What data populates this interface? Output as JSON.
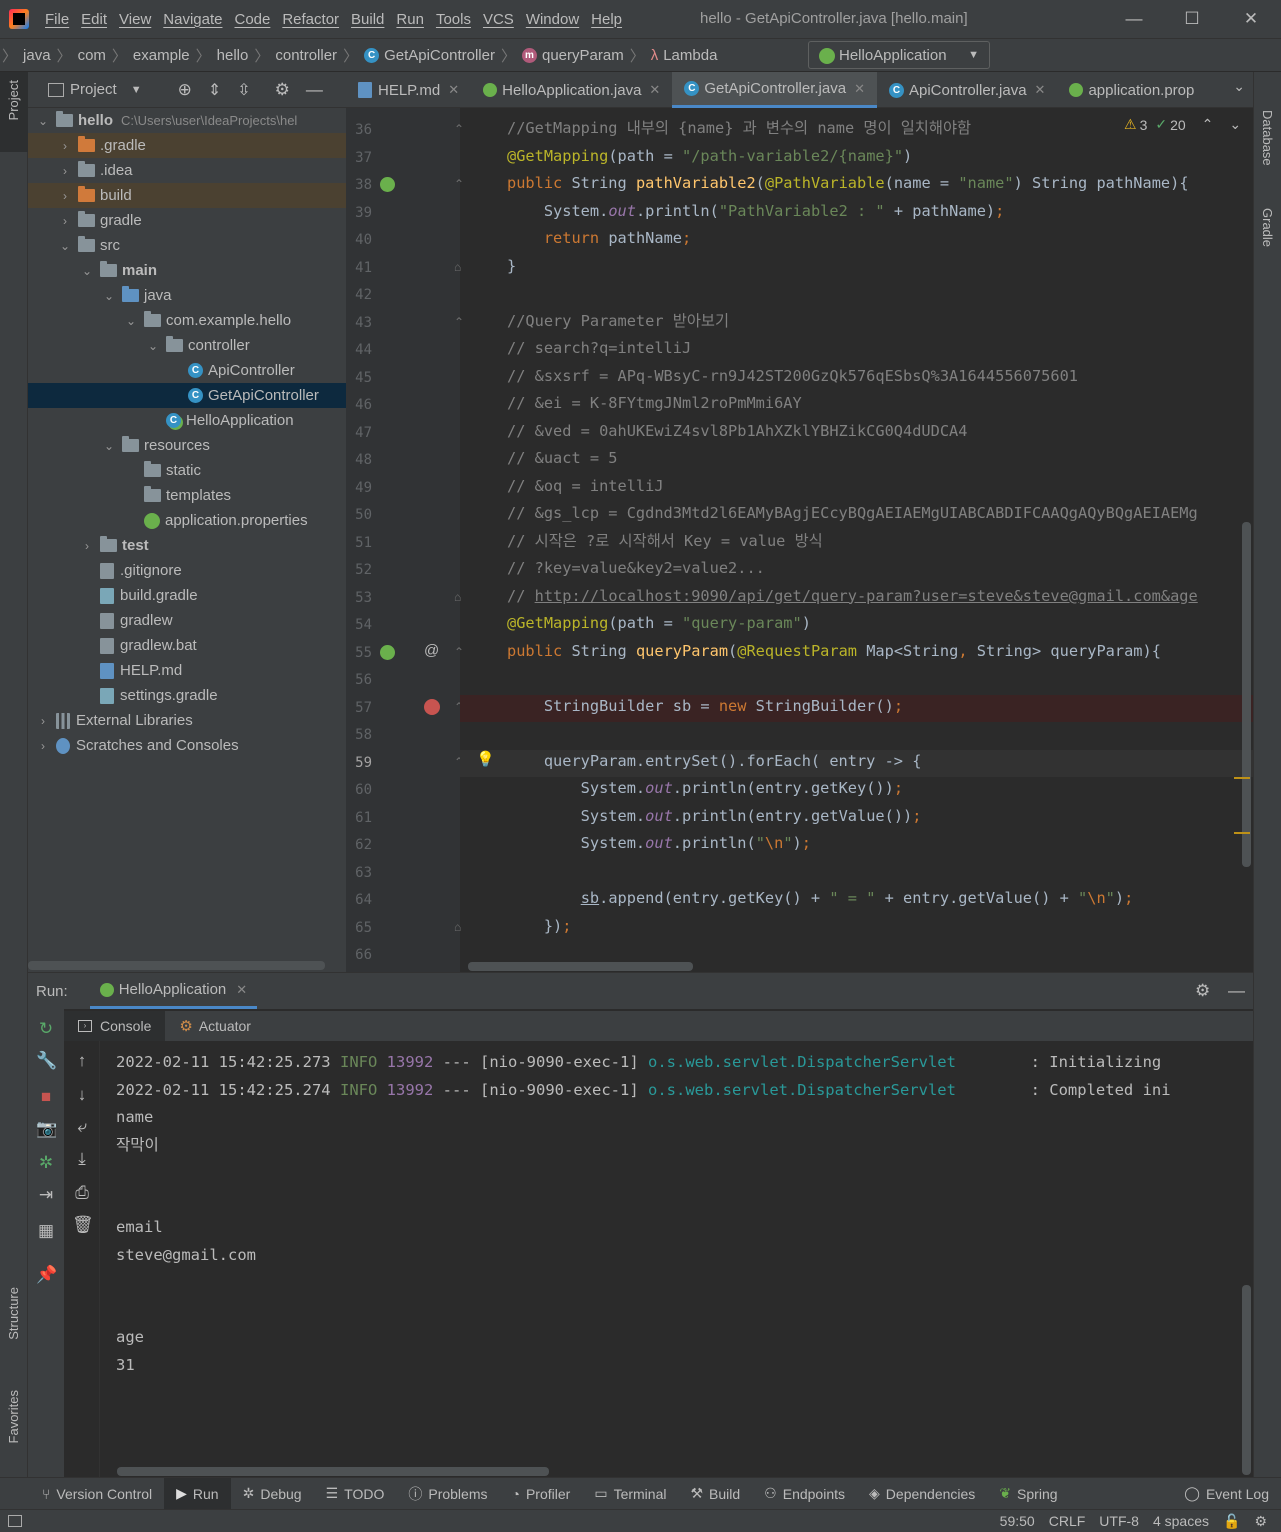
{
  "menu": [
    "File",
    "Edit",
    "View",
    "Navigate",
    "Code",
    "Refactor",
    "Build",
    "Run",
    "Tools",
    "VCS",
    "Window",
    "Help"
  ],
  "window_title": "hello - GetApiController.java [hello.main]",
  "breadcrumbs": [
    "java",
    "com",
    "example",
    "hello",
    "controller",
    "GetApiController",
    "queryParam",
    "Lambda"
  ],
  "run_config": "HelloApplication",
  "project_panel": {
    "title": "Project",
    "tree": [
      {
        "label": "hello",
        "extra": "C:\\Users\\user\\IdeaProjects\\hel",
        "depth": 0,
        "arrow": "open",
        "icon": "folder",
        "bold": true
      },
      {
        "label": ".gradle",
        "depth": 1,
        "arrow": "closed",
        "icon": "folder-orange"
      },
      {
        "label": ".idea",
        "depth": 1,
        "arrow": "closed",
        "icon": "folder"
      },
      {
        "label": "build",
        "depth": 1,
        "arrow": "closed",
        "icon": "folder-orange"
      },
      {
        "label": "gradle",
        "depth": 1,
        "arrow": "closed",
        "icon": "folder"
      },
      {
        "label": "src",
        "depth": 1,
        "arrow": "open",
        "icon": "folder"
      },
      {
        "label": "main",
        "depth": 2,
        "arrow": "open",
        "icon": "folder",
        "bold": true
      },
      {
        "label": "java",
        "depth": 3,
        "arrow": "open",
        "icon": "folder-blue"
      },
      {
        "label": "com.example.hello",
        "depth": 4,
        "arrow": "open",
        "icon": "folder"
      },
      {
        "label": "controller",
        "depth": 5,
        "arrow": "open",
        "icon": "folder"
      },
      {
        "label": "ApiController",
        "depth": 6,
        "arrow": "none",
        "icon": "class"
      },
      {
        "label": "GetApiController",
        "depth": 6,
        "arrow": "none",
        "icon": "class",
        "selected": true
      },
      {
        "label": "HelloApplication",
        "depth": 5,
        "arrow": "none",
        "icon": "spring-class"
      },
      {
        "label": "resources",
        "depth": 3,
        "arrow": "open",
        "icon": "folder"
      },
      {
        "label": "static",
        "depth": 4,
        "arrow": "none",
        "icon": "folder"
      },
      {
        "label": "templates",
        "depth": 4,
        "arrow": "none",
        "icon": "folder"
      },
      {
        "label": "application.properties",
        "depth": 4,
        "arrow": "none",
        "icon": "spring"
      },
      {
        "label": "test",
        "depth": 2,
        "arrow": "closed",
        "icon": "folder",
        "bold": true
      },
      {
        "label": ".gitignore",
        "depth": 2,
        "arrow": "none",
        "icon": "file"
      },
      {
        "label": "build.gradle",
        "depth": 2,
        "arrow": "none",
        "icon": "gradle"
      },
      {
        "label": "gradlew",
        "depth": 2,
        "arrow": "none",
        "icon": "file"
      },
      {
        "label": "gradlew.bat",
        "depth": 2,
        "arrow": "none",
        "icon": "file"
      },
      {
        "label": "HELP.md",
        "depth": 2,
        "arrow": "none",
        "icon": "md"
      },
      {
        "label": "settings.gradle",
        "depth": 2,
        "arrow": "none",
        "icon": "gradle"
      },
      {
        "label": "External Libraries",
        "depth": 0,
        "arrow": "closed",
        "icon": "lib"
      },
      {
        "label": "Scratches and Consoles",
        "depth": 0,
        "arrow": "closed",
        "icon": "scratch"
      }
    ]
  },
  "tabs": [
    {
      "label": "HELP.md",
      "icon": "md"
    },
    {
      "label": "HelloApplication.java",
      "icon": "spring"
    },
    {
      "label": "GetApiController.java",
      "icon": "class",
      "active": true
    },
    {
      "label": "ApiController.java",
      "icon": "class"
    },
    {
      "label": "application.prop",
      "icon": "spring"
    }
  ],
  "inspections": {
    "warnings": "3",
    "ok": "20"
  },
  "code": [
    {
      "n": "36",
      "html": "<span class='cm'>//GetMapping 내부의 {name} 과 변수의 name 명이 일치해야함</span>"
    },
    {
      "n": "37",
      "html": "<span class='an'>@GetMapping</span>(path = <span class='st'>\"/path-variable2/{name}\"</span>)"
    },
    {
      "n": "38",
      "html": "<span class='kw'>public </span>String <span class='fn'>pathVariable2</span>(<span class='an'>@PathVariable</span>(name = <span class='st'>\"name\"</span>) String pathName){"
    },
    {
      "n": "39",
      "html": "    System.<span class='it'>out</span>.println(<span class='st'>\"PathVariable2 : \"</span> + pathName)<span class='kw'>;</span>"
    },
    {
      "n": "40",
      "html": "    <span class='kw'>return </span>pathName<span class='kw'>;</span>"
    },
    {
      "n": "41",
      "html": "}"
    },
    {
      "n": "42",
      "html": ""
    },
    {
      "n": "43",
      "html": "<span class='cm'>//Query Parameter 받아보기</span>"
    },
    {
      "n": "44",
      "html": "<span class='cm'>// search?q=intelliJ</span>"
    },
    {
      "n": "45",
      "html": "<span class='cm'>// &amp;sxsrf = APq-WBsyC-rn9J42ST200GzQk576qESbsQ%3A1644556075601</span>"
    },
    {
      "n": "46",
      "html": "<span class='cm'>// &amp;ei = K-8FYtmgJNml2roPmMmi6AY</span>"
    },
    {
      "n": "47",
      "html": "<span class='cm'>// &amp;ved = 0ahUKEwiZ4svl8Pb1AhXZklYBHZikCG0Q4dUDCA4</span>"
    },
    {
      "n": "48",
      "html": "<span class='cm'>// &amp;uact = 5</span>"
    },
    {
      "n": "49",
      "html": "<span class='cm'>// &amp;oq = intelliJ</span>"
    },
    {
      "n": "50",
      "html": "<span class='cm'>// &amp;gs_lcp = Cgdnd3Mtd2l6EAMyBAgjECcyBQgAEIAEMgUIABCABDIFCAAQgAQyBQgAEIAEMg</span>"
    },
    {
      "n": "51",
      "html": "<span class='cm'>// 시작은 ?로 시작해서 Key = value 방식</span>"
    },
    {
      "n": "52",
      "html": "<span class='cm'>// ?key=value&amp;key2=value2...</span>"
    },
    {
      "n": "53",
      "html": "<span class='cm'>// <u>http://localhost:9090/api/get/query-param?user=steve&amp;steve@gmail.com&amp;age</u></span>"
    },
    {
      "n": "54",
      "html": "<span class='an'>@GetMapping</span>(path = <span class='st'>\"query-param\"</span>)"
    },
    {
      "n": "55",
      "html": "<span class='kw'>public </span>String <span class='fn'>queryParam</span>(<span class='an'>@RequestParam </span>Map&lt;String<span class='kw'>, </span>String&gt; queryParam){"
    },
    {
      "n": "56",
      "html": ""
    },
    {
      "n": "57",
      "html": "    StringBuilder sb = <span class='kw'>new </span>StringBuilder()<span class='kw'>;</span>"
    },
    {
      "n": "58",
      "html": ""
    },
    {
      "n": "59",
      "html": "    queryParam.entrySet().forEach( entry -&gt; {"
    },
    {
      "n": "60",
      "html": "        System.<span class='it'>out</span>.println(entry.getKey())<span class='kw'>;</span>"
    },
    {
      "n": "61",
      "html": "        System.<span class='it'>out</span>.println(entry.getValue())<span class='kw'>;</span>"
    },
    {
      "n": "62",
      "html": "        System.<span class='it'>out</span>.println(<span class='st'>\"<span class='kw'>\\n</span>\"</span>)<span class='kw'>;</span>"
    },
    {
      "n": "63",
      "html": ""
    },
    {
      "n": "64",
      "html": "        <u>sb</u>.append(entry.getKey() + <span class='st'>\" = \"</span> + entry.getValue() + <span class='st'>\"<span class='kw'>\\n</span>\"</span>)<span class='kw'>;</span>"
    },
    {
      "n": "65",
      "html": "    })<span class='kw'>;</span>"
    },
    {
      "n": "66",
      "html": ""
    }
  ],
  "run_panel": {
    "label": "Run:",
    "tab": "HelloApplication",
    "sub_tabs": [
      "Console",
      "Actuator"
    ],
    "log_lines": [
      {
        "ts": "2022-02-11 15:42:25.273",
        "level": "INFO",
        "pid": "13992",
        "sep": "---",
        "thread": "[nio-9090-exec-1]",
        "logger": "o.s.web.servlet.DispatcherServlet",
        "msg": ": Initializing"
      },
      {
        "ts": "2022-02-11 15:42:25.274",
        "level": "INFO",
        "pid": "13992",
        "sep": "---",
        "thread": "[nio-9090-exec-1]",
        "logger": "o.s.web.servlet.DispatcherServlet",
        "msg": ": Completed ini"
      }
    ],
    "output": [
      "name",
      "작막이",
      "",
      "",
      "email",
      "steve@gmail.com",
      "",
      "",
      "age",
      "31"
    ]
  },
  "left_stripe": [
    "Project",
    "Structure",
    "Favorites"
  ],
  "right_stripe": [
    "Database",
    "Gradle"
  ],
  "bottom_tools": [
    "Version Control",
    "Run",
    "Debug",
    "TODO",
    "Problems",
    "Profiler",
    "Terminal",
    "Build",
    "Endpoints",
    "Dependencies",
    "Spring",
    "Event Log"
  ],
  "status": {
    "position": "59:50",
    "line_sep": "CRLF",
    "encoding": "UTF-8",
    "indent": "4 spaces"
  }
}
